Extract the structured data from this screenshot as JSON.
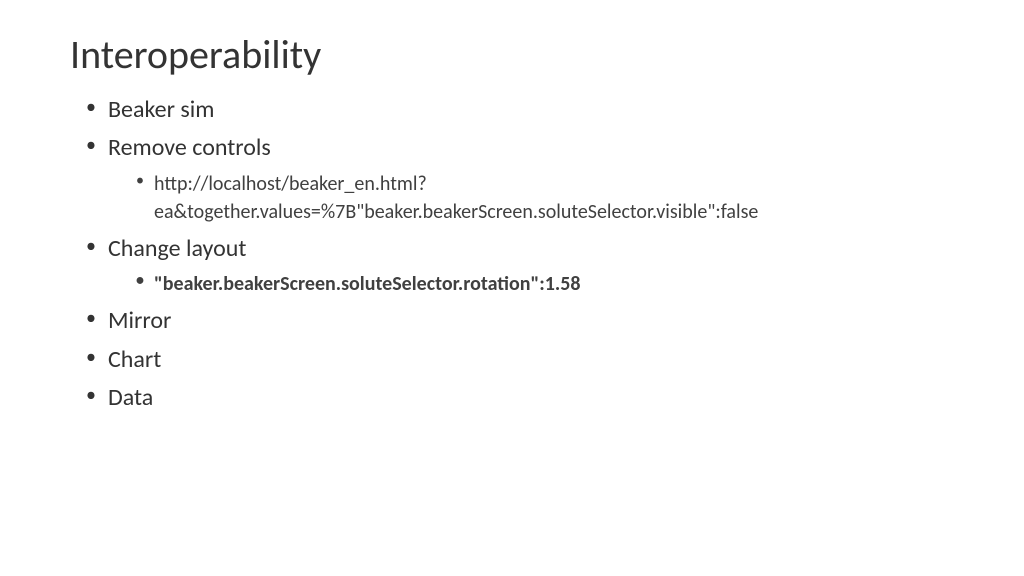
{
  "title": "Interoperability",
  "bullets": {
    "item1": "Beaker sim",
    "item2": "Remove controls",
    "item2_sub": "http://localhost/beaker_en.html?ea&together.values=%7B\"beaker.beakerScreen.soluteSelector.visible\":false",
    "item3": "Change layout",
    "item3_sub": "\"beaker.beakerScreen.soluteSelector.rotation\":1.58",
    "item4": "Mirror",
    "item5": "Chart",
    "item6": "Data"
  }
}
